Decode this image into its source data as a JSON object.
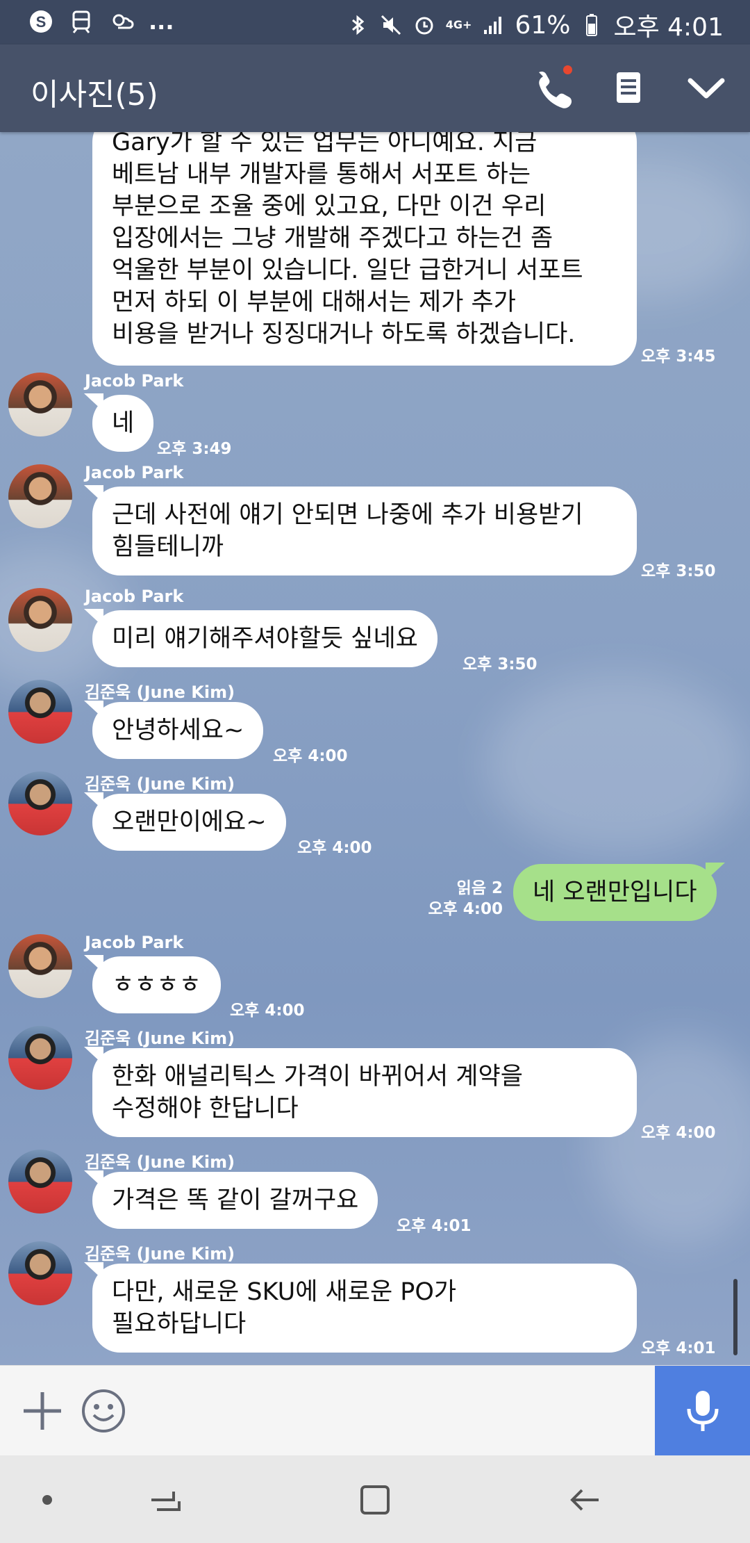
{
  "status_bar": {
    "more": "...",
    "battery_pct": "61%",
    "time": "오후 4:01",
    "network": "4G+"
  },
  "header": {
    "title": "이사진(5)",
    "icons": [
      "phone-icon",
      "notes-icon",
      "chevron-down-icon"
    ],
    "notification_color": "#e8472f"
  },
  "messages": [
    {
      "sender": "",
      "lines": [
        "Gary가 할 수 있는 업무는 아니예요. 지금",
        "베트남 내부 개발자를 통해서 서포트 하는",
        "부분으로 조율 중에 있고요, 다만 이건 우리",
        "입장에서는 그냥 개발해 주겠다고 하는건 좀",
        "억울한 부분이 있습니다. 일단 급한거니 서포트",
        "먼저 하되 이 부분에 대해서는 제가 추가",
        "비용을 받거나 징징대거나 하도록 하겠습니다."
      ],
      "time": "오후 3:45"
    },
    {
      "sender": "Jacob Park",
      "lines": [
        "네"
      ],
      "time": "오후 3:49"
    },
    {
      "sender": "Jacob Park",
      "lines": [
        "근데 사전에 얘기 안되면 나중에 추가 비용받기",
        "힘들테니까"
      ],
      "time": "오후 3:50"
    },
    {
      "sender": "Jacob Park",
      "lines": [
        "미리 얘기해주셔야할듯 싶네요"
      ],
      "time": "오후 3:50"
    },
    {
      "sender": "김준욱 (June Kim)",
      "lines": [
        "안녕하세요~"
      ],
      "time": "오후 4:00"
    },
    {
      "sender": "김준욱 (June Kim)",
      "lines": [
        "오랜만이에요~"
      ],
      "time": "오후 4:00"
    },
    {
      "sender": "me",
      "lines": [
        "네 오랜만입니다"
      ],
      "time": "오후 4:00",
      "read": "읽음 2"
    },
    {
      "sender": "Jacob Park",
      "lines": [
        "ㅎㅎㅎㅎ"
      ],
      "time": "오후 4:00"
    },
    {
      "sender": "김준욱 (June Kim)",
      "lines": [
        "한화 애널리틱스 가격이 바뀌어서 계약을",
        "수정해야 한답니다"
      ],
      "time": "오후 4:00"
    },
    {
      "sender": "김준욱 (June Kim)",
      "lines": [
        "가격은 똑 같이 갈꺼구요"
      ],
      "time": "오후 4:01"
    },
    {
      "sender": "김준욱 (June Kim)",
      "lines": [
        "다만, 새로운 SKU에 새로운 PO가",
        "필요하답니다"
      ],
      "time": "오후 4:01"
    }
  ],
  "input": {
    "placeholder": "",
    "icons": [
      "plus-icon",
      "emoji-icon",
      "mic-icon"
    ],
    "mic_color": "#4f7fe0"
  },
  "nav_bar": {
    "icons": [
      "dot-icon",
      "recent-apps-icon",
      "home-icon",
      "back-icon"
    ]
  },
  "colors": {
    "header": "#475269",
    "my_bubble": "#a6e08a",
    "chat_bg": "#8aa1c4"
  }
}
